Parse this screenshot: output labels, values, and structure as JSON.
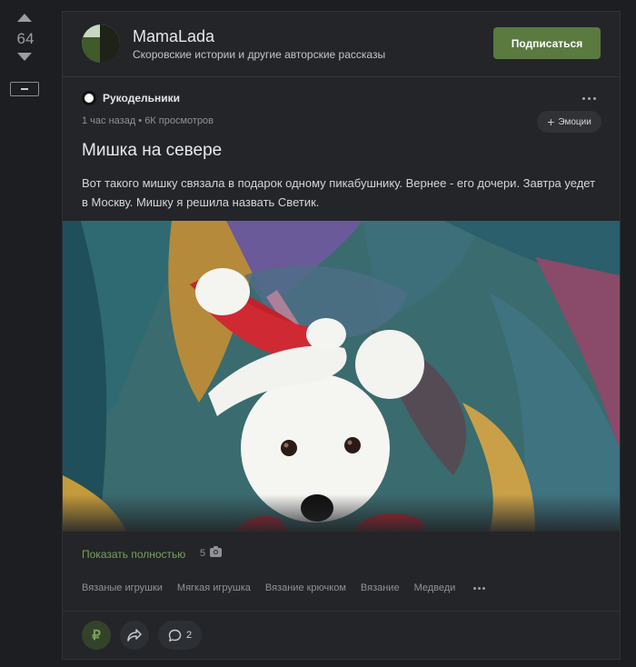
{
  "rating": {
    "value": "64"
  },
  "community": {
    "name": "MamaLada",
    "description": "Скоровские истории и другие авторские рассказы",
    "subscribe_label": "Подписаться"
  },
  "post": {
    "author": "Рукодельники",
    "meta": "1 час назад • 6К просмотров",
    "emotions_label": "Эмоции",
    "title": "Мишка на севере",
    "text": "Вот такого мишку связала в подарок одному пикабушнику. Вернее - его дочери. Завтра уедет в Москву. Мишку я решила назвать Светик.",
    "show_full_label": "Показать полностью",
    "photo_count": "5",
    "tags": [
      "Вязаные игрушки",
      "Мягкая игрушка",
      "Вязание крючком",
      "Вязание",
      "Медведи"
    ],
    "comment_count": "2",
    "donate_symbol": "₽"
  },
  "icons": [
    "vote-up-icon",
    "vote-down-icon",
    "collapse-icon",
    "more-dots-icon",
    "plus-icon",
    "camera-icon",
    "share-icon",
    "comment-icon",
    "ruble-icon"
  ],
  "colors": {
    "background": "#1c1e21",
    "card": "#232529",
    "accent_green": "#5a7a40",
    "link_green": "#79a25a"
  }
}
